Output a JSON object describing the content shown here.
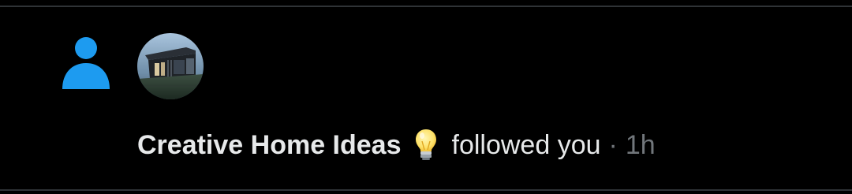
{
  "notification": {
    "type_icon": "person-icon",
    "avatar_icon": "modern-house-avatar",
    "display_name": "Creative Home Ideas",
    "emoji_icon": "lightbulb-emoji",
    "action_text": "followed you",
    "separator": "·",
    "timestamp": "1h"
  },
  "colors": {
    "background": "#000000",
    "accent_blue": "#1d9bf0",
    "primary_text": "#e7e9ea",
    "secondary_text": "#71767b",
    "divider": "#2f3336"
  }
}
